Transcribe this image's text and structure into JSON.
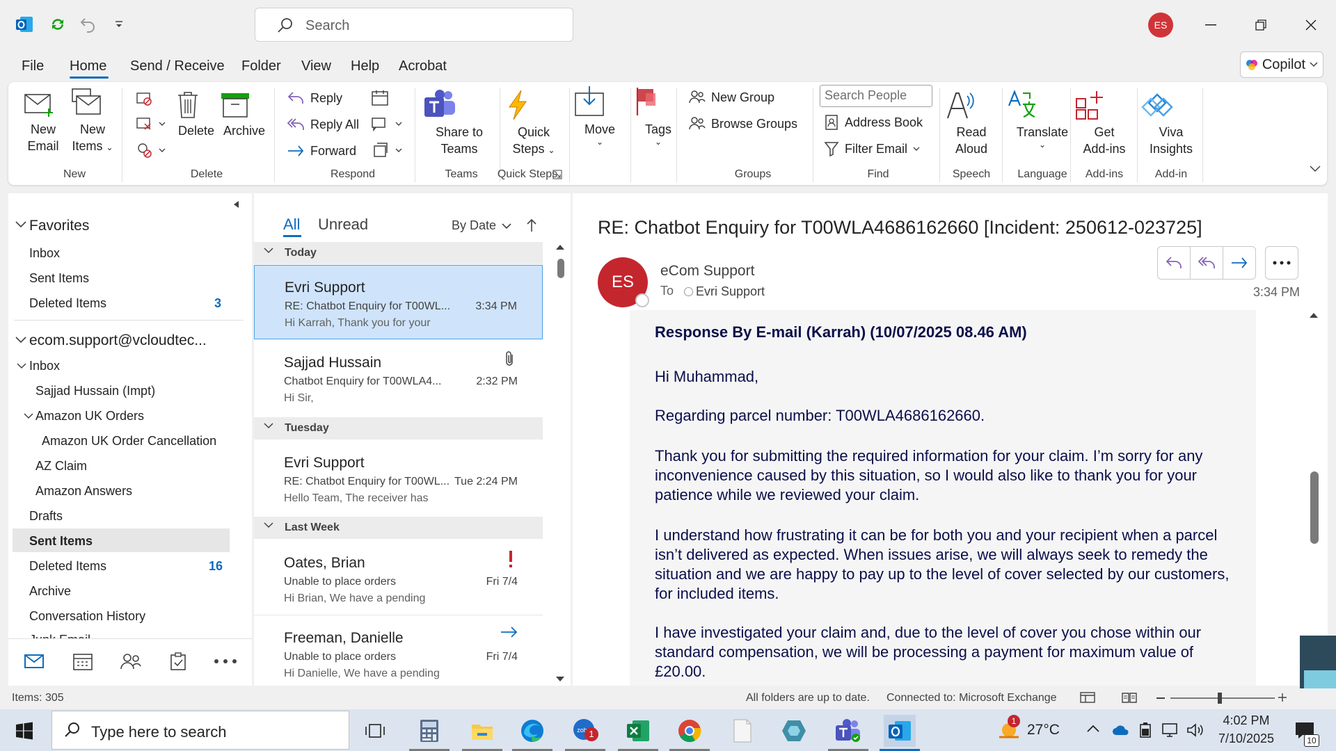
{
  "titlebar": {
    "search_placeholder": "Search",
    "user_initials": "ES"
  },
  "menu": [
    "File",
    "Home",
    "Send / Receive",
    "Folder",
    "View",
    "Help",
    "Acrobat"
  ],
  "copilot_label": "Copilot",
  "ribbon": {
    "new_email": [
      "New",
      "Email"
    ],
    "new_items": [
      "New",
      "Items"
    ],
    "delete": "Delete",
    "archive": "Archive",
    "reply": "Reply",
    "reply_all": "Reply All",
    "forward": "Forward",
    "share_teams": [
      "Share to",
      "Teams"
    ],
    "quick_steps": [
      "Quick",
      "Steps"
    ],
    "move": "Move",
    "tags": "Tags",
    "new_group": "New Group",
    "browse_groups": "Browse Groups",
    "search_people_placeholder": "Search People",
    "address_book": "Address Book",
    "filter_email": "Filter Email",
    "read_aloud": [
      "Read",
      "Aloud"
    ],
    "translate": "Translate",
    "get_addins": [
      "Get",
      "Add-ins"
    ],
    "viva": [
      "Viva",
      "Insights"
    ],
    "groups": {
      "new": "New",
      "delete": "Delete",
      "respond": "Respond",
      "teams": "Teams",
      "quick_steps": "Quick Steps",
      "groups": "Groups",
      "find": "Find",
      "speech": "Speech",
      "language": "Language",
      "addins1": "Add-ins",
      "addins2": "Add-in"
    }
  },
  "nav": {
    "favorites": "Favorites",
    "fav_inbox": "Inbox",
    "fav_sent": "Sent Items",
    "fav_deleted": "Deleted Items",
    "fav_deleted_count": "3",
    "account": "ecom.support@vcloudtec...",
    "inbox": "Inbox",
    "sajjad": "Sajjad Hussain (Impt)",
    "amazon_orders": "Amazon UK Orders",
    "amazon_cancel": "Amazon UK Order Cancellation",
    "az_claim": "AZ Claim",
    "amazon_answers": "Amazon Answers",
    "drafts": "Drafts",
    "sent": "Sent Items",
    "deleted": "Deleted Items",
    "deleted_count": "16",
    "archive": "Archive",
    "conv_history": "Conversation History",
    "partial": "Junk Email"
  },
  "list": {
    "tab_all": "All",
    "tab_unread": "Unread",
    "sort": "By Date",
    "groups": [
      "Today",
      "Tuesday",
      "Last Week"
    ],
    "messages": [
      {
        "from": "Evri Support",
        "subject": "RE: Chatbot Enquiry for T00WL...",
        "preview": "Hi Karrah,  Thank you for your",
        "time": "3:34 PM"
      },
      {
        "from": "Sajjad Hussain",
        "subject": "Chatbot Enquiry for T00WLA4...",
        "preview": "Hi Sir,",
        "time": "2:32 PM"
      },
      {
        "from": "Evri Support",
        "subject": "RE: Chatbot Enquiry for T00WL...",
        "preview": "Hello Team,  The receiver has",
        "time": "Tue 2:24 PM"
      },
      {
        "from": "Oates, Brian",
        "subject": "Unable to place orders",
        "preview": "Hi Brian,  We have a pending",
        "time": "Fri 7/4"
      },
      {
        "from": "Freeman, Danielle",
        "subject": "Unable to place orders",
        "preview": "Hi Danielle,  We have a pending",
        "time": "Fri 7/4"
      }
    ]
  },
  "reading": {
    "subject": "RE: Chatbot Enquiry for T00WLA4686162660 [Incident: 250612-023725]",
    "sender": "eCom Support",
    "sender_initials": "ES",
    "to_label": "To",
    "to": "Evri Support",
    "time": "3:34 PM",
    "body": [
      "Response By E-mail (Karrah) (10/07/2025 08.46 AM)",
      "Hi Muhammad,",
      "Regarding parcel number: T00WLA4686162660.",
      "Thank you for submitting the required information for your claim. I’m sorry for any inconvenience caused by this situation, so I would also like to thank you for your patience while we reviewed your claim.",
      "I understand how frustrating it can be for both you and your recipient when a parcel isn’t delivered as expected. When issues arise, we will always seek to remedy the situation and we are happy to pay up to the level of cover selected by our customers, for included items.",
      "I have investigated your claim and, due to the level of cover you chose within our standard compensation, we will be processing a payment for maximum value of £20.00."
    ]
  },
  "status": {
    "items": "Items: 305",
    "uptodate": "All folders are up to date.",
    "connected": "Connected to: Microsoft Exchange"
  },
  "taskbar": {
    "search": "Type here to search",
    "teams_badge": "1",
    "weather_badge": "1",
    "temp": "27°C",
    "time": "4:02 PM",
    "date": "7/10/2025",
    "notif_count": "10"
  }
}
